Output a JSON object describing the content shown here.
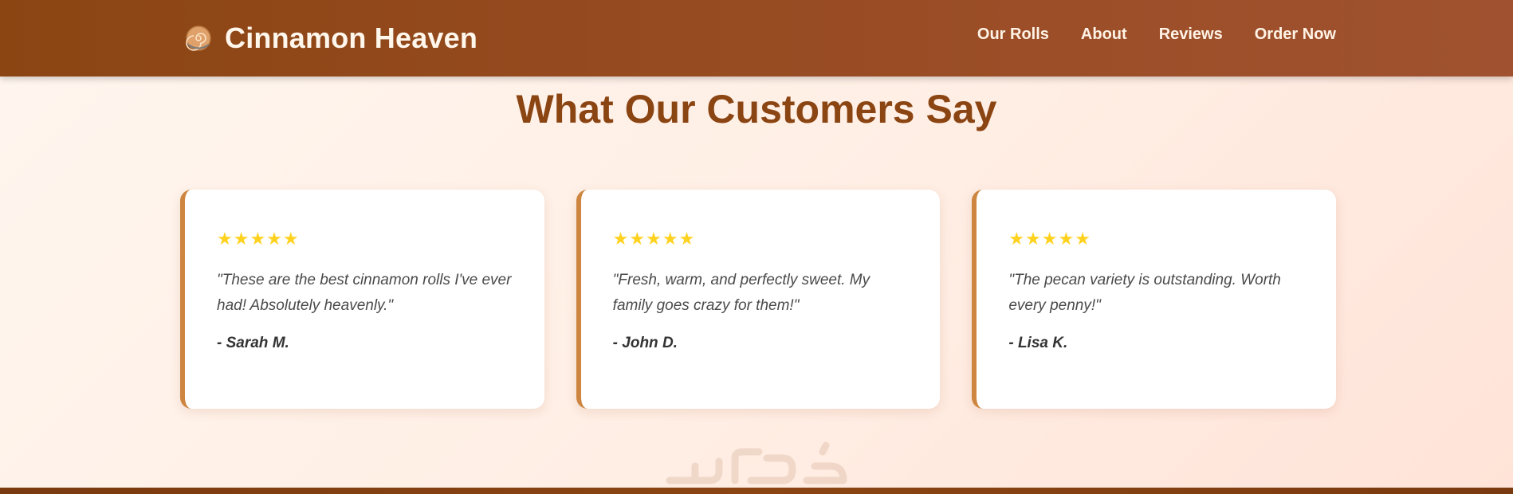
{
  "header": {
    "brand_name": "Cinnamon Heaven",
    "logo_icon": "cinnamon-roll-icon",
    "nav": [
      "Our Rolls",
      "About",
      "Reviews",
      "Order Now"
    ]
  },
  "reviews_section": {
    "title": "What Our Customers Say",
    "cards": [
      {
        "stars": "★★★★★",
        "rating": 5,
        "quote": "\"These are the best cinnamon rolls I've ever had! Absolutely heavenly.\"",
        "author": "- Sarah M."
      },
      {
        "stars": "★★★★★",
        "rating": 5,
        "quote": "\"Fresh, warm, and perfectly sweet. My family goes crazy for them!\"",
        "author": "- John D."
      },
      {
        "stars": "★★★★★",
        "rating": 5,
        "quote": "\"The pecan variety is outstanding. Worth every penny!\"",
        "author": "- Lisa K."
      }
    ]
  },
  "watermark": {
    "text": "خمسات"
  },
  "colors": {
    "header_bg": "#8b4513",
    "accent": "#cd853f",
    "title": "#8b4513",
    "star": "#ffd21f"
  }
}
